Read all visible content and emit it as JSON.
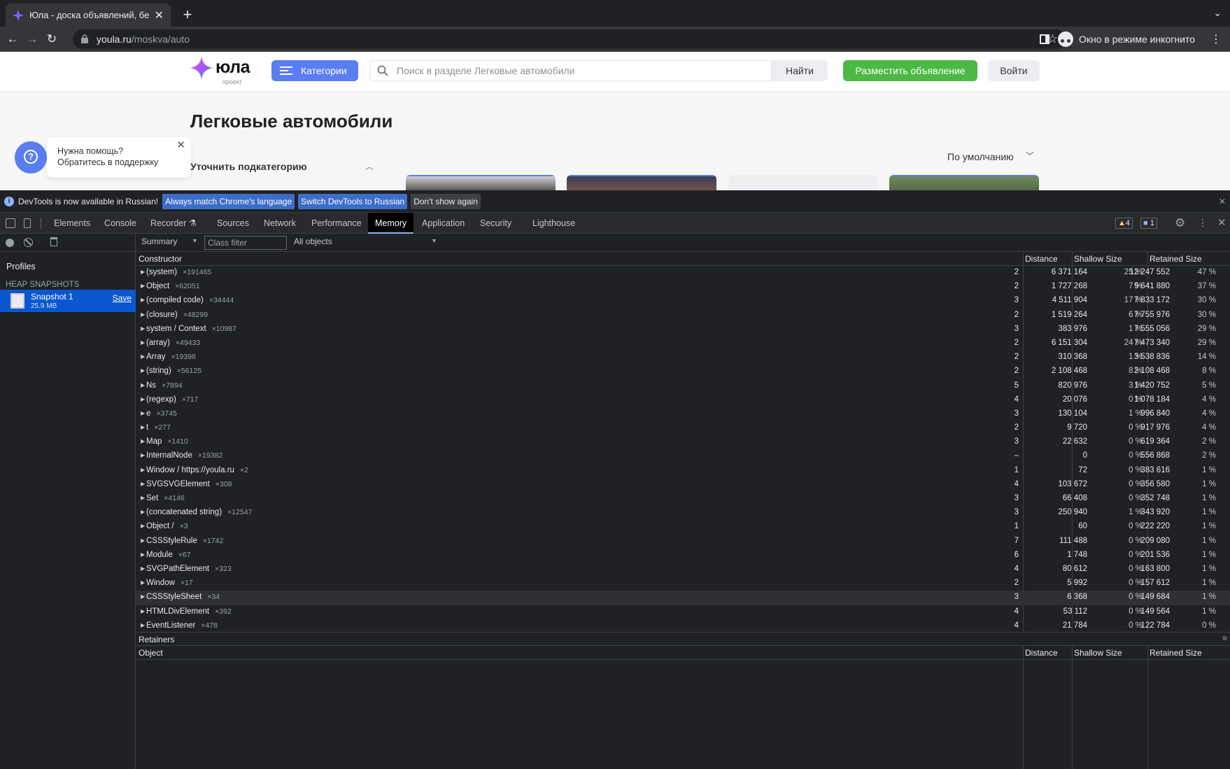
{
  "browser": {
    "tab_title": "Юла - доска объявлений, бесплатные объявления",
    "url_host": "youla.ru",
    "url_path": "/moskva/auto",
    "incognito_label": "Окно в режиме инкогнито"
  },
  "site": {
    "logo_text": "юла",
    "logo_sub": "проект",
    "categories_label": "Категории",
    "search_placeholder": "Поиск в разделе Легковые автомобили",
    "find_label": "Найти",
    "post_ad_label": "Разместить объявление",
    "login_label": "Войти",
    "page_title": "Легковые автомобили",
    "help_line1": "Нужна помощь?",
    "help_line2": "Обратитесь в поддержку",
    "subcategory_label": "Уточнить подкатегорию",
    "sort_label": "По умолчанию",
    "brand_color": "#5a7df2",
    "accent_green": "#4cb944"
  },
  "devtools": {
    "infobar": {
      "text": "DevTools is now available in Russian!",
      "match_label": "Always match Chrome's language",
      "switch_label": "Switch DevTools to Russian",
      "dismiss_label": "Don't show again"
    },
    "tabs": [
      "Elements",
      "Console",
      "Recorder",
      "Sources",
      "Network",
      "Performance",
      "Memory",
      "Application",
      "Security",
      "Lighthouse"
    ],
    "active_tab": "Memory",
    "warnings_count": "4",
    "messages_count": "1",
    "profiles_title": "Profiles",
    "heap_snapshots_title": "HEAP SNAPSHOTS",
    "snapshot": {
      "name": "Snapshot 1",
      "size": "25.9 MB",
      "save_label": "Save"
    },
    "view_select": "Summary",
    "class_filter_placeholder": "Class filter",
    "objects_select": "All objects",
    "columns": {
      "constructor": "Constructor",
      "distance": "Distance",
      "shallow": "Shallow Size",
      "retained": "Retained Size"
    },
    "retainers_title": "Retainers",
    "retainer_columns": {
      "object": "Object",
      "distance": "Distance",
      "shallow": "Shallow Size",
      "retained": "Retained Size"
    },
    "rows": [
      {
        "name": "(system)",
        "count": "×191465",
        "distance": "2",
        "shallow": "6 371 164",
        "shallow_pct": "25 %",
        "retained": "12 247 552",
        "retained_pct": "47 %"
      },
      {
        "name": "Object",
        "count": "×62051",
        "distance": "2",
        "shallow": "1 727 268",
        "shallow_pct": "7 %",
        "retained": "9 641 880",
        "retained_pct": "37 %"
      },
      {
        "name": "(compiled code)",
        "count": "×34444",
        "distance": "3",
        "shallow": "4 511 904",
        "shallow_pct": "17 %",
        "retained": "7 833 172",
        "retained_pct": "30 %"
      },
      {
        "name": "(closure)",
        "count": "×48299",
        "distance": "2",
        "shallow": "1 519 264",
        "shallow_pct": "6 %",
        "retained": "7 755 976",
        "retained_pct": "30 %"
      },
      {
        "name": "system / Context",
        "count": "×10987",
        "distance": "3",
        "shallow": "383 976",
        "shallow_pct": "1 %",
        "retained": "7 555 056",
        "retained_pct": "29 %"
      },
      {
        "name": "(array)",
        "count": "×49433",
        "distance": "2",
        "shallow": "6 151 304",
        "shallow_pct": "24 %",
        "retained": "7 473 340",
        "retained_pct": "29 %"
      },
      {
        "name": "Array",
        "count": "×19398",
        "distance": "2",
        "shallow": "310 368",
        "shallow_pct": "1 %",
        "retained": "3 538 836",
        "retained_pct": "14 %"
      },
      {
        "name": "(string)",
        "count": "×56125",
        "distance": "2",
        "shallow": "2 108 468",
        "shallow_pct": "8 %",
        "retained": "2 108 468",
        "retained_pct": "8 %"
      },
      {
        "name": "Ns",
        "count": "×7894",
        "distance": "5",
        "shallow": "820 976",
        "shallow_pct": "3 %",
        "retained": "1 420 752",
        "retained_pct": "5 %"
      },
      {
        "name": "(regexp)",
        "count": "×717",
        "distance": "4",
        "shallow": "20 076",
        "shallow_pct": "0 %",
        "retained": "1 078 184",
        "retained_pct": "4 %"
      },
      {
        "name": "e",
        "count": "×3745",
        "distance": "3",
        "shallow": "130 104",
        "shallow_pct": "1 %",
        "retained": "996 840",
        "retained_pct": "4 %"
      },
      {
        "name": "t",
        "count": "×277",
        "distance": "2",
        "shallow": "9 720",
        "shallow_pct": "0 %",
        "retained": "917 976",
        "retained_pct": "4 %"
      },
      {
        "name": "Map",
        "count": "×1410",
        "distance": "3",
        "shallow": "22 632",
        "shallow_pct": "0 %",
        "retained": "619 364",
        "retained_pct": "2 %"
      },
      {
        "name": "InternalNode",
        "count": "×19382",
        "distance": "–",
        "shallow": "0",
        "shallow_pct": "0 %",
        "retained": "556 868",
        "retained_pct": "2 %"
      },
      {
        "name": "Window / https://youla.ru",
        "count": "×2",
        "distance": "1",
        "shallow": "72",
        "shallow_pct": "0 %",
        "retained": "383 616",
        "retained_pct": "1 %"
      },
      {
        "name": "SVGSVGElement",
        "count": "×308",
        "distance": "4",
        "shallow": "103 672",
        "shallow_pct": "0 %",
        "retained": "356 580",
        "retained_pct": "1 %"
      },
      {
        "name": "Set",
        "count": "×4146",
        "distance": "3",
        "shallow": "66 408",
        "shallow_pct": "0 %",
        "retained": "352 748",
        "retained_pct": "1 %"
      },
      {
        "name": "(concatenated string)",
        "count": "×12547",
        "distance": "3",
        "shallow": "250 940",
        "shallow_pct": "1 %",
        "retained": "343 920",
        "retained_pct": "1 %"
      },
      {
        "name": "Object /",
        "count": "×3",
        "distance": "1",
        "shallow": "60",
        "shallow_pct": "0 %",
        "retained": "222 220",
        "retained_pct": "1 %"
      },
      {
        "name": "CSSStyleRule",
        "count": "×1742",
        "distance": "7",
        "shallow": "111 488",
        "shallow_pct": "0 %",
        "retained": "209 080",
        "retained_pct": "1 %"
      },
      {
        "name": "Module",
        "count": "×67",
        "distance": "6",
        "shallow": "1 748",
        "shallow_pct": "0 %",
        "retained": "201 536",
        "retained_pct": "1 %"
      },
      {
        "name": "SVGPathElement",
        "count": "×323",
        "distance": "4",
        "shallow": "80 612",
        "shallow_pct": "0 %",
        "retained": "163 800",
        "retained_pct": "1 %"
      },
      {
        "name": "Window",
        "count": "×17",
        "distance": "2",
        "shallow": "5 992",
        "shallow_pct": "0 %",
        "retained": "157 612",
        "retained_pct": "1 %"
      },
      {
        "name": "CSSStyleSheet",
        "count": "×34",
        "distance": "3",
        "shallow": "6 368",
        "shallow_pct": "0 %",
        "retained": "149 684",
        "retained_pct": "1 %",
        "selected": true
      },
      {
        "name": "HTMLDivElement",
        "count": "×392",
        "distance": "4",
        "shallow": "53 112",
        "shallow_pct": "0 %",
        "retained": "149 564",
        "retained_pct": "1 %"
      },
      {
        "name": "EventListener",
        "count": "×478",
        "distance": "4",
        "shallow": "21 784",
        "shallow_pct": "0 %",
        "retained": "122 784",
        "retained_pct": "0 %"
      }
    ]
  }
}
